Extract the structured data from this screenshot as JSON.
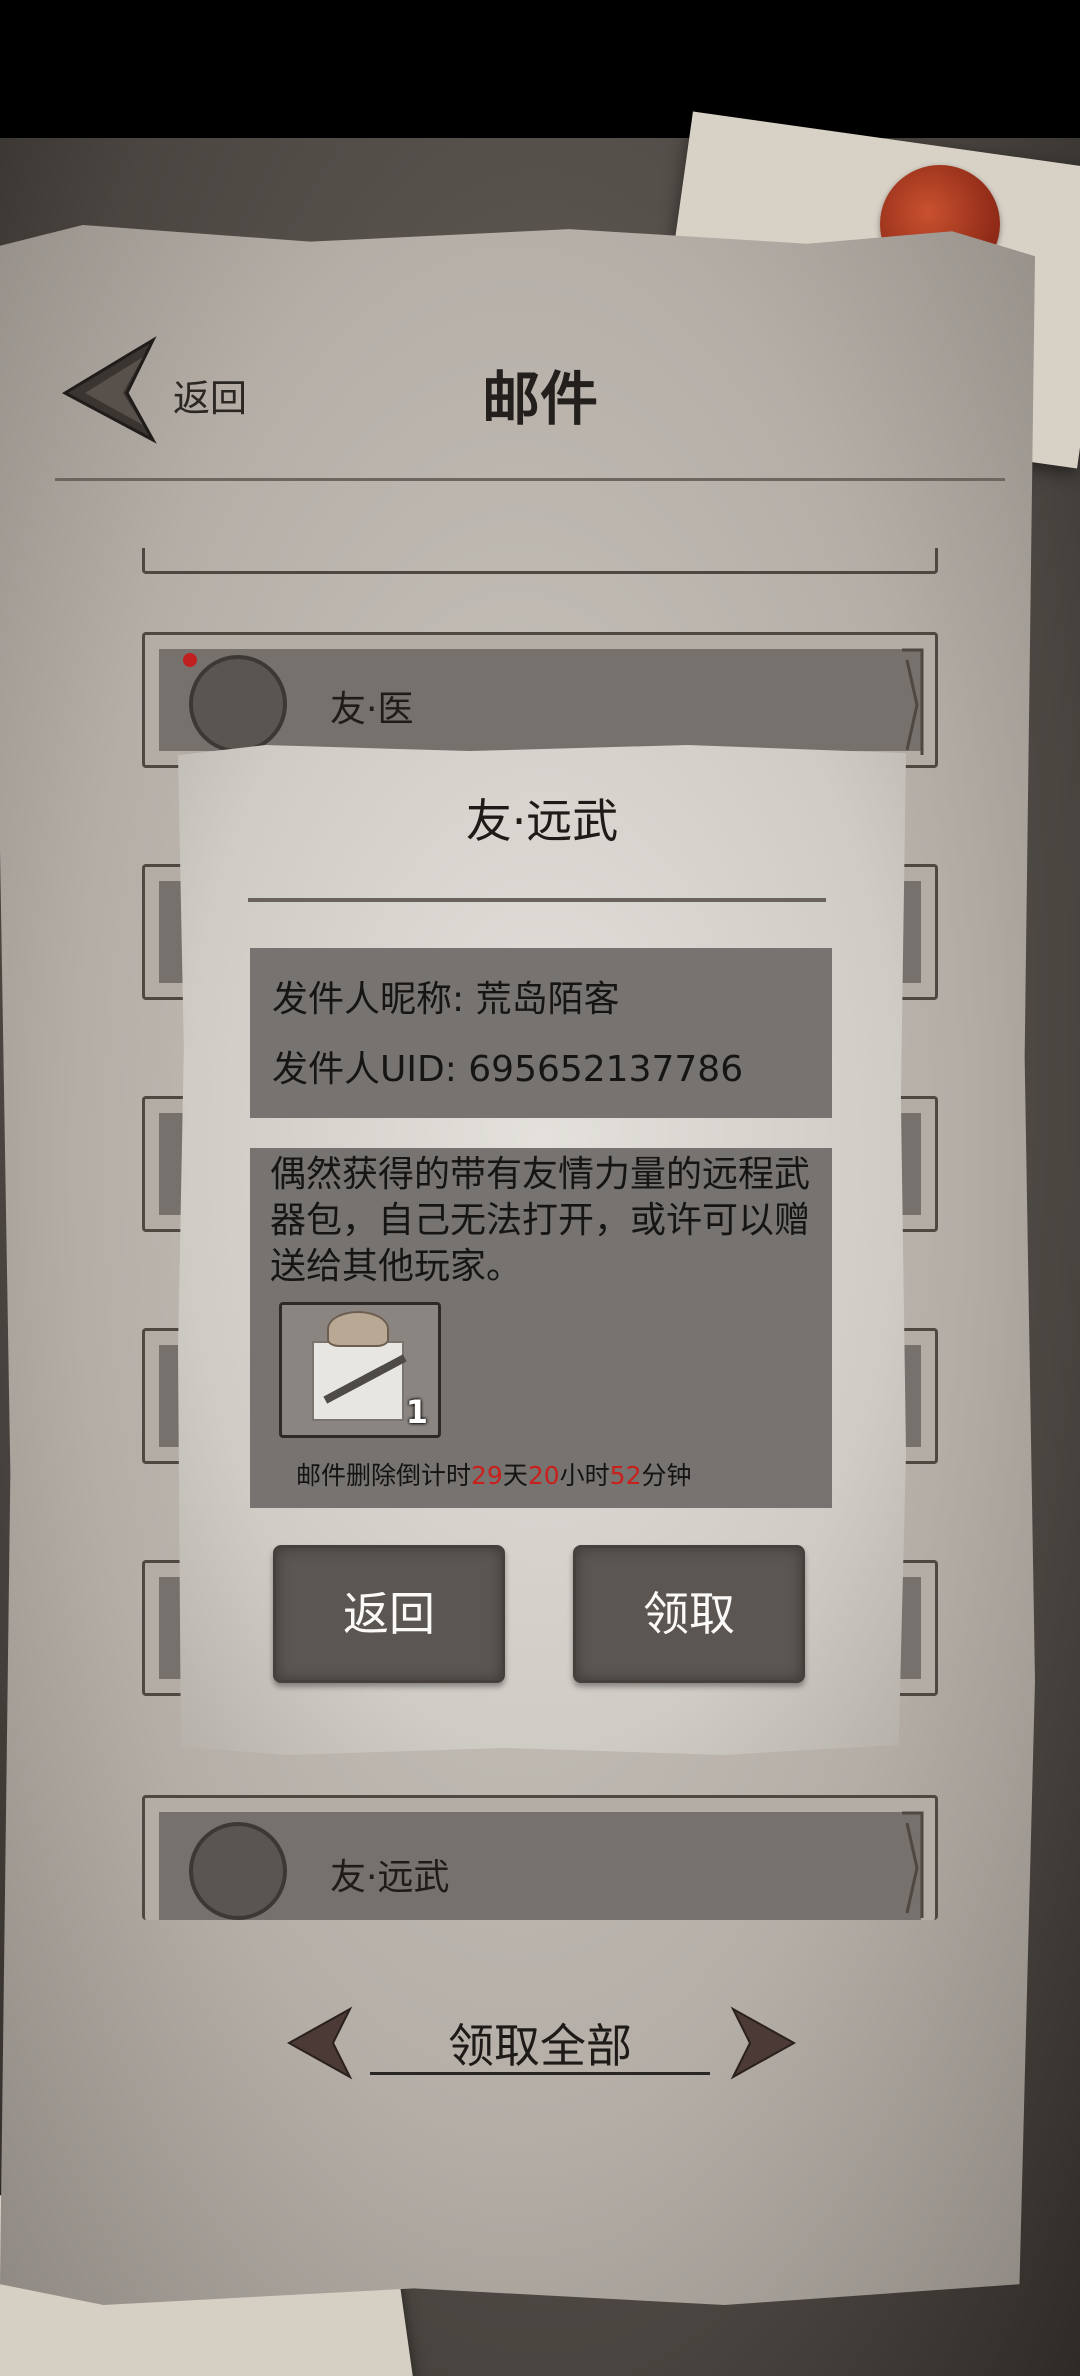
{
  "header": {
    "back_label": "返回",
    "title": "邮件"
  },
  "mail_list": [
    {
      "title": "友·医",
      "unread": true
    },
    {
      "title": "友·远武",
      "unread": false
    }
  ],
  "dialog": {
    "title": "友·远武",
    "sender_nickname_line": "发件人昵称: 荒岛陌客",
    "sender_uid_line": "发件人UID: 695652137786",
    "description": "偶然获得的带有友情力量的远程武器包，自己无法打开，或许可以赠送给其他玩家。",
    "item": {
      "icon": "weapon-gift-box-icon",
      "count": "1"
    },
    "countdown": {
      "prefix": "邮件删除倒计时",
      "days": "29",
      "days_unit": "天",
      "hours": "20",
      "hours_unit": "小时",
      "minutes": "52",
      "minutes_unit": "分钟"
    },
    "back_button": "返回",
    "claim_button": "领取"
  },
  "footer": {
    "claim_all": "领取全部"
  },
  "colors": {
    "countdown_number": "#c8201c",
    "button_bg": "#5b5652",
    "wax_seal": "#a8361f"
  }
}
